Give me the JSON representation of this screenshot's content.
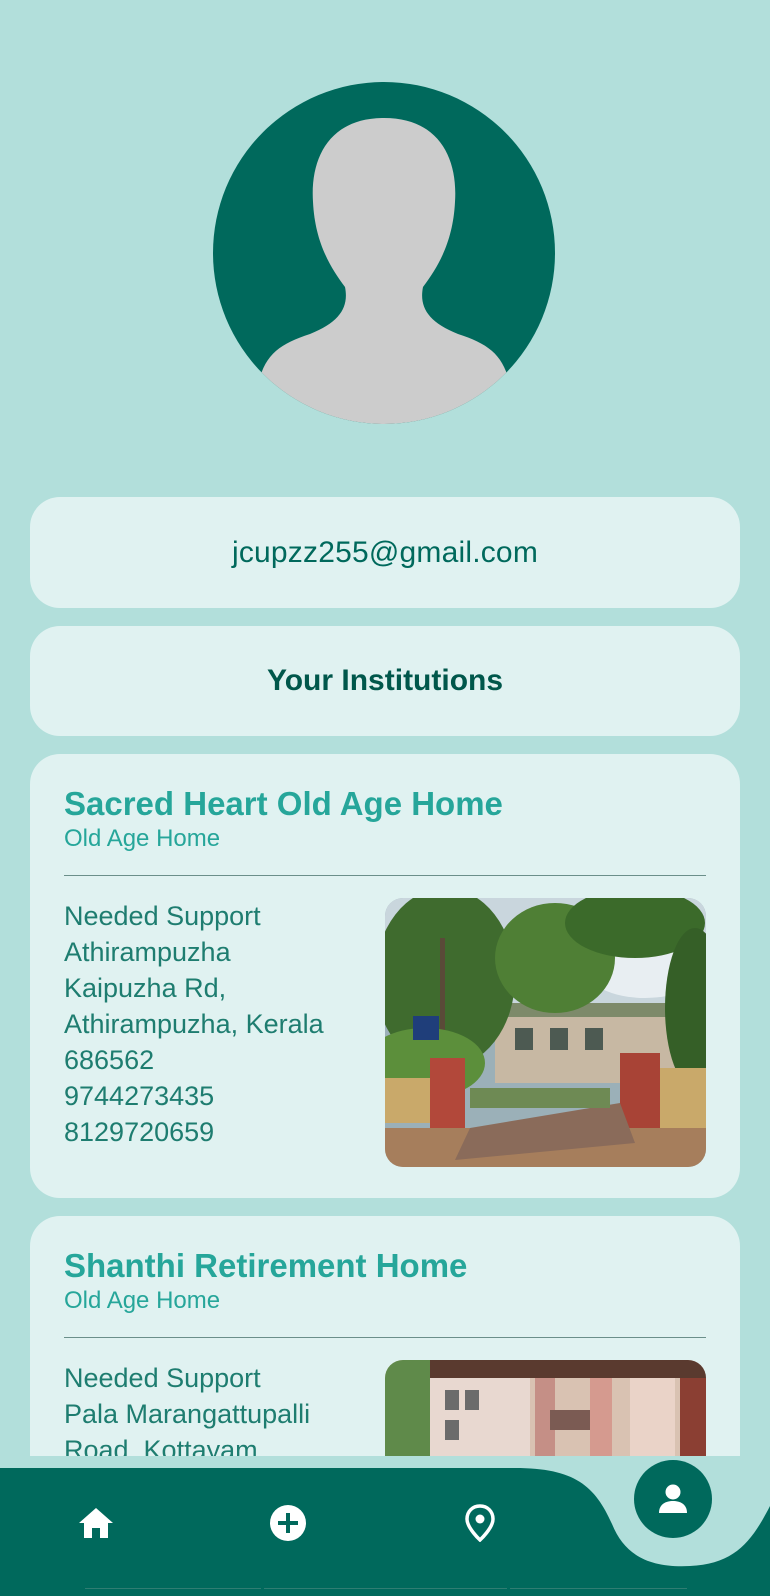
{
  "profile": {
    "avatar_icon": "person-placeholder-icon",
    "email": "jcupzz255@gmail.com"
  },
  "section_title": "Your Institutions",
  "institutions": [
    {
      "name": "Sacred Heart Old Age Home",
      "type": "Old Age Home",
      "lines": [
        "Needed Support",
        "Athirampuzha",
        "Kaipuzha Rd,",
        "Athirampuzha, Kerala",
        "686562",
        "9744273435",
        "8129720659"
      ]
    },
    {
      "name": "Shanthi Retirement Home",
      "type": "Old Age Home",
      "lines": [
        "Needed Support",
        "Pala Marangattupalli",
        "Road, Kottayam"
      ]
    }
  ],
  "bottom_nav": {
    "items": [
      {
        "icon": "home-icon"
      },
      {
        "icon": "add-circle-icon"
      },
      {
        "icon": "location-pin-icon"
      },
      {
        "icon": "person-icon"
      }
    ]
  },
  "colors": {
    "background": "#b2dfdb",
    "card": "#e0f2f1",
    "primary_dark": "#00695c",
    "accent": "#26a69a"
  }
}
